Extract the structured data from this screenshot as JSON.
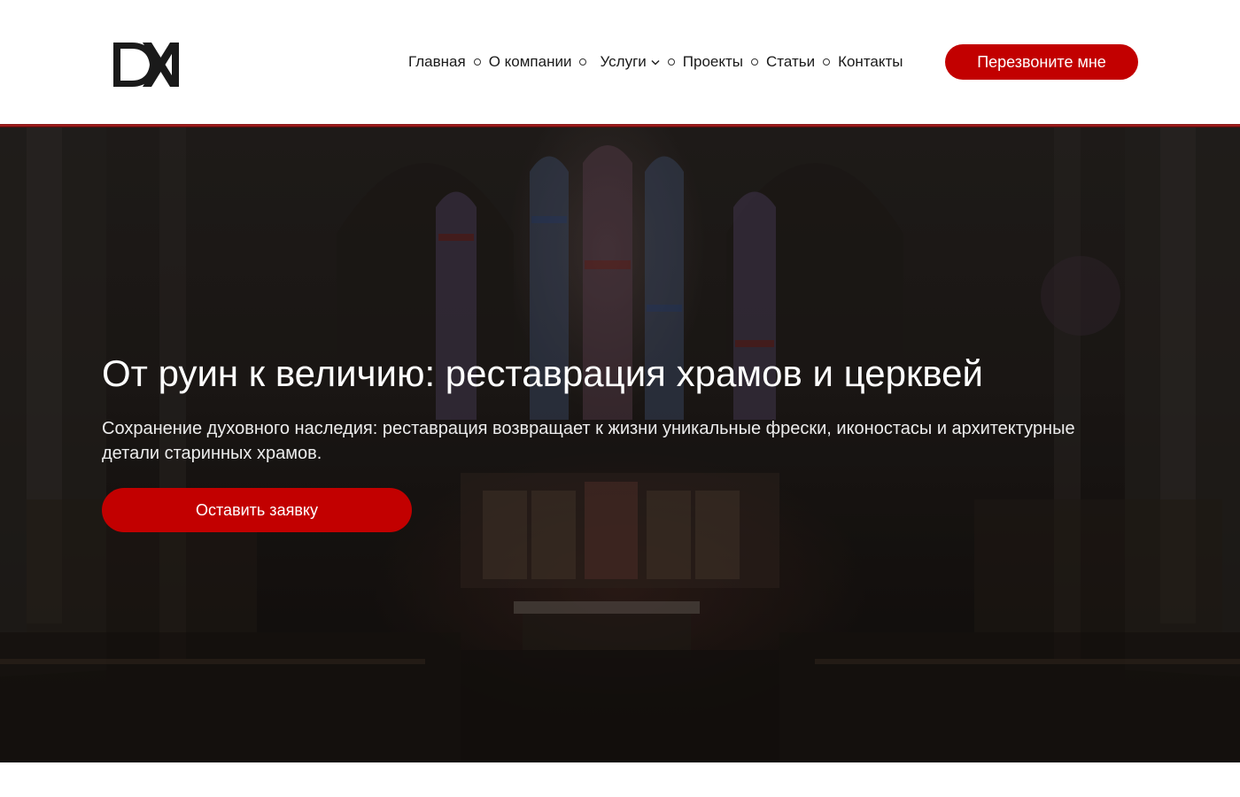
{
  "header": {
    "logo_alt": "DX logo",
    "nav": [
      {
        "label": "Главная"
      },
      {
        "label": "О компании"
      },
      {
        "label": "Услуги",
        "has_dropdown": true
      },
      {
        "label": "Проекты"
      },
      {
        "label": "Статьи"
      },
      {
        "label": "Контакты"
      }
    ],
    "callback_label": "Перезвоните мне"
  },
  "hero": {
    "title": "От руин к величию: реставрация храмов и церквей",
    "subtitle": "Сохранение духовного наследия: реставрация возвращает к жизни уникальные фрески, иконостасы и архитектурные детали старинных храмов.",
    "cta_label": "Оставить заявку"
  },
  "colors": {
    "accent": "#c20000",
    "header_bg": "#ffffff",
    "hero_text": "#ffffff"
  },
  "icons": {
    "separator": "circle-bullet-icon",
    "dropdown": "chevron-down-icon"
  }
}
